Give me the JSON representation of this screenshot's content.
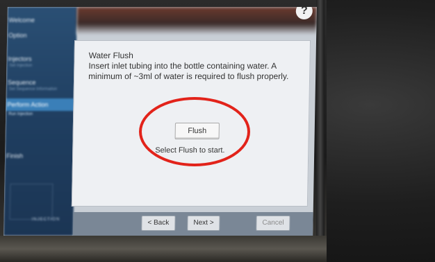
{
  "sidebar": {
    "items": [
      {
        "label": "Welcome"
      },
      {
        "label": "Option"
      },
      {
        "label": "Injectors",
        "sub": "Set Injection"
      },
      {
        "label": "Sequence",
        "sub": "Set Sequence Information"
      },
      {
        "label": "Perform Action",
        "sub": "Run Injection"
      },
      {
        "label": "Finish"
      }
    ],
    "footer": "INJECTION"
  },
  "help_icon": "?",
  "dialog": {
    "title": "Water Flush",
    "instructions": "Insert inlet tubing into the bottle containing water.  A minimum of ~3ml of water is required to flush properly.",
    "flush_button": "Flush",
    "hint": "Select Flush to start."
  },
  "nav": {
    "back": "< Back",
    "next": "Next >",
    "cancel": "Cancel"
  },
  "annotation": {
    "color": "#e2231a"
  }
}
